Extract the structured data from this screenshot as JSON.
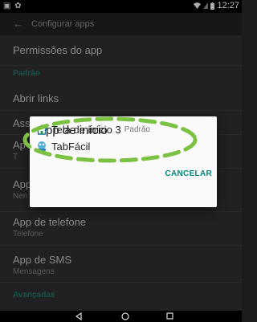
{
  "status": {
    "time": "12:27",
    "left_icons": "▣ ✿",
    "icons": [
      "wifi-icon",
      "sim-icon",
      "battery-icon"
    ]
  },
  "header": {
    "title": "Configurar apps"
  },
  "list": {
    "permissions": "Permissões do app",
    "section_default": "Padrão",
    "open_links": "Abrir links",
    "assistant_partial": "Ass",
    "browser_partial": "Ap",
    "browser_sub_partial": "T",
    "home_partial": "App",
    "home_sub_partial": "Nen",
    "phone_title": "App de telefone",
    "phone_sub": "Telefone",
    "sms_title": "App de SMS",
    "sms_sub": "Mensagens",
    "section_advanced": "Avançadas"
  },
  "dialog": {
    "title": "App de início",
    "options": [
      {
        "label": "Tela de início 3",
        "badge": "Padrão",
        "icon": "home-icon"
      },
      {
        "label": "TabFácil",
        "badge": "",
        "icon": "tabfacil-app-icon"
      }
    ],
    "cancel": "CANCELAR"
  },
  "colors": {
    "accent": "#00897b",
    "annotation": "#7cc242",
    "section": "#1f6f66"
  }
}
